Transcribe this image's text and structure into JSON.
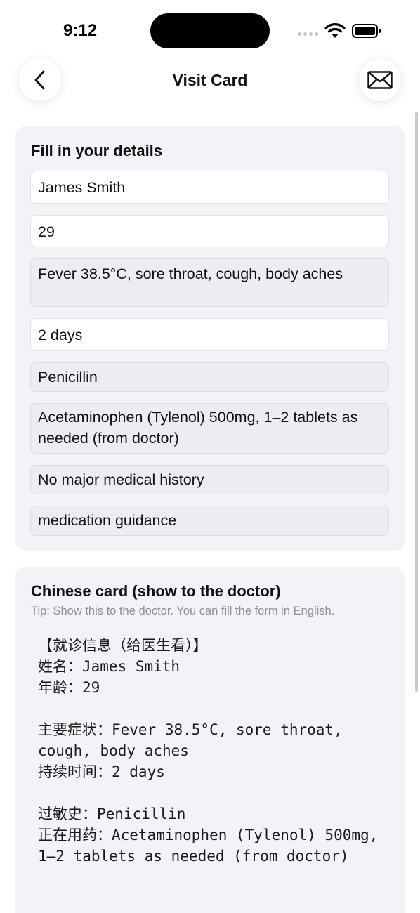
{
  "status_bar": {
    "time": "9:12"
  },
  "nav": {
    "title": "Visit Card",
    "back_icon": "chevron-left-icon",
    "mail_icon": "envelope-icon"
  },
  "form": {
    "title": "Fill in your details",
    "fields": [
      {
        "name": "name-field",
        "value": "James Smith"
      },
      {
        "name": "age-field",
        "value": "29"
      },
      {
        "name": "symptoms-field",
        "value": "Fever 38.5°C, sore throat, cough, body aches"
      },
      {
        "name": "duration-field",
        "value": "2 days"
      },
      {
        "name": "allergies-field",
        "value": "Penicillin"
      },
      {
        "name": "medications-field",
        "value": "Acetaminophen (Tylenol) 500mg, 1–2 tablets as needed (from doctor)"
      },
      {
        "name": "history-field",
        "value": "No major medical history"
      },
      {
        "name": "request-field",
        "value": "medication guidance"
      }
    ]
  },
  "chinese_card": {
    "title": "Chinese card (show to the doctor)",
    "tip": "Tip: Show this to the doctor. You can fill the form in English.",
    "lines": [
      "【就诊信息（给医生看）】",
      "姓名：James Smith",
      "年龄：29",
      "",
      "主要症状：Fever 38.5°C, sore throat, cough, body aches",
      "持续时间：2 days",
      "",
      "过敏史：Penicillin",
      "正在用药：Acetaminophen (Tylenol) 500mg, 1–2 tablets as needed (from doctor)"
    ]
  }
}
